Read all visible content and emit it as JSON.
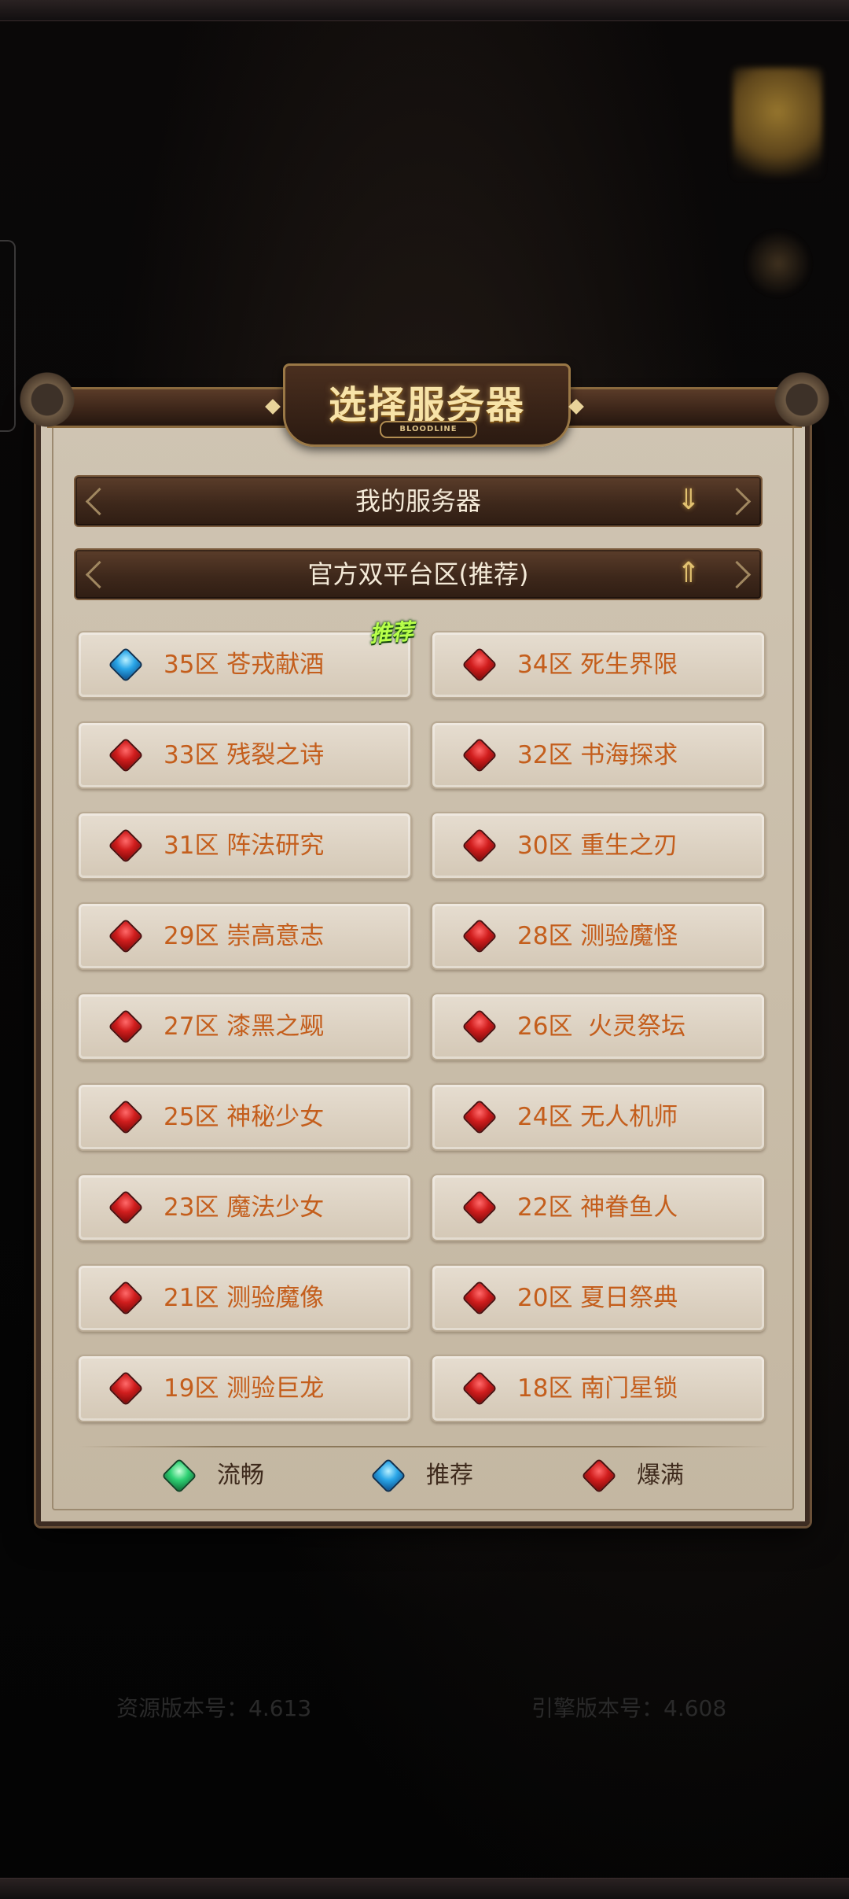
{
  "dialog": {
    "title": "选择服务器",
    "title_sub": "BLOODLINE"
  },
  "sections": {
    "my_servers": "我的服务器",
    "official": "官方双平台区(推荐)"
  },
  "recommend_tag": "推荐",
  "servers": [
    {
      "label": "35区 苍戎献酒",
      "status": "blue"
    },
    {
      "label": "34区 死生界限",
      "status": "red"
    },
    {
      "label": "33区 残裂之诗",
      "status": "red"
    },
    {
      "label": "32区 书海探求",
      "status": "red"
    },
    {
      "label": "31区 阵法研究",
      "status": "red"
    },
    {
      "label": "30区 重生之刃",
      "status": "red"
    },
    {
      "label": "29区 崇高意志",
      "status": "red"
    },
    {
      "label": "28区 测验魔怪",
      "status": "red"
    },
    {
      "label": "27区 漆黑之觋",
      "status": "red"
    },
    {
      "label": "26区  火灵祭坛",
      "status": "red"
    },
    {
      "label": "25区 神秘少女",
      "status": "red"
    },
    {
      "label": "24区 无人机师",
      "status": "red"
    },
    {
      "label": "23区 魔法少女",
      "status": "red"
    },
    {
      "label": "22区 神眷鱼人",
      "status": "red"
    },
    {
      "label": "21区 测验魔像",
      "status": "red"
    },
    {
      "label": "20区 夏日祭典",
      "status": "red"
    },
    {
      "label": "19区 测验巨龙",
      "status": "red"
    },
    {
      "label": "18区 南门星锁",
      "status": "red"
    }
  ],
  "legend": [
    {
      "label": "流畅",
      "status": "green"
    },
    {
      "label": "推荐",
      "status": "blue"
    },
    {
      "label": "爆满",
      "status": "red"
    }
  ],
  "footer": {
    "resource_version": "资源版本号：4.613",
    "engine_version": "引擎版本号：4.608"
  }
}
